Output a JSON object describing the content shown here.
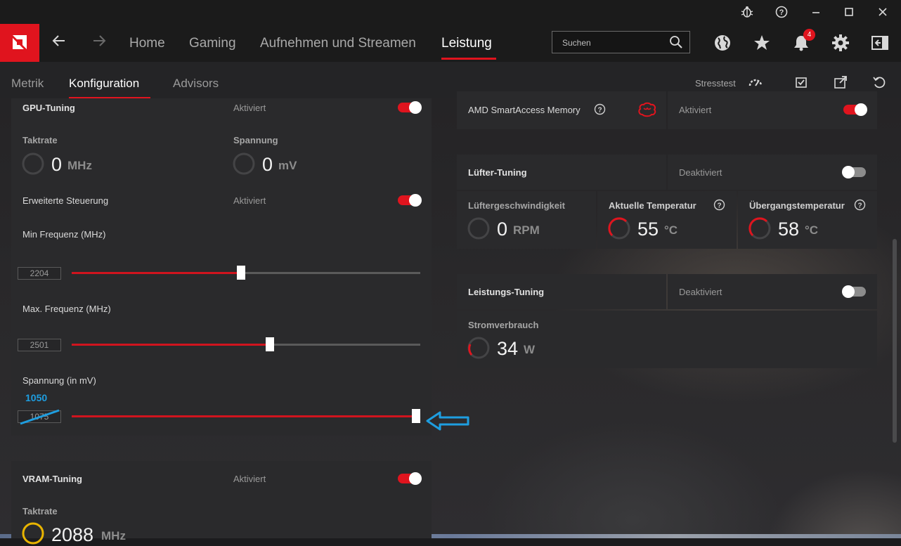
{
  "titlebar": {
    "icons": [
      "bug-icon",
      "help-icon",
      "minimize-icon",
      "maximize-icon",
      "close-icon"
    ]
  },
  "nav": {
    "items": [
      "Home",
      "Gaming",
      "Aufnehmen und Streamen",
      "Leistung"
    ],
    "active": "Leistung",
    "search_placeholder": "Suchen",
    "notification_count": "4",
    "accent_color": "#e0141e"
  },
  "subnav": {
    "tabs": [
      "Metrik",
      "Konfiguration",
      "Advisors"
    ],
    "active": "Konfiguration",
    "stresstest_label": "Stresstest"
  },
  "gpu_tuning": {
    "title": "GPU-Tuning",
    "status": "Aktiviert",
    "enabled": true,
    "taktrate_label": "Taktrate",
    "taktrate_value": "0",
    "taktrate_unit": "MHz",
    "spannung_label": "Spannung",
    "spannung_value": "0",
    "spannung_unit": "mV",
    "erweitert_label": "Erweiterte Steuerung",
    "erweitert_status": "Aktiviert",
    "min_freq_label": "Min Frequenz (MHz)",
    "min_freq_value": "2204",
    "min_freq_fraction": 0.49,
    "max_freq_label": "Max. Frequenz (MHz)",
    "max_freq_value": "2501",
    "max_freq_fraction": 0.57,
    "voltage_label": "Spannung (in mV)",
    "voltage_value": "1075",
    "voltage_fraction": 1.0,
    "annotation_value": "1050"
  },
  "vram_tuning": {
    "title": "VRAM-Tuning",
    "status": "Aktiviert",
    "taktrate_label": "Taktrate",
    "taktrate_value": "2088",
    "taktrate_unit": "MHz"
  },
  "sam": {
    "label": "AMD SmartAccess Memory",
    "status": "Aktiviert"
  },
  "fan_tuning": {
    "title": "Lüfter-Tuning",
    "status": "Deaktiviert",
    "fan_speed_label": "Lüftergeschwindigkeit",
    "fan_speed_value": "0",
    "fan_speed_unit": "RPM",
    "temp_label": "Aktuelle Temperatur",
    "temp_value": "55",
    "temp_unit": "°C",
    "junction_label": "Übergangstemperatur",
    "junction_value": "58",
    "junction_unit": "°C"
  },
  "power_tuning": {
    "title": "Leistungs-Tuning",
    "status": "Deaktiviert",
    "power_label": "Stromverbrauch",
    "power_value": "34",
    "power_unit": "W"
  }
}
